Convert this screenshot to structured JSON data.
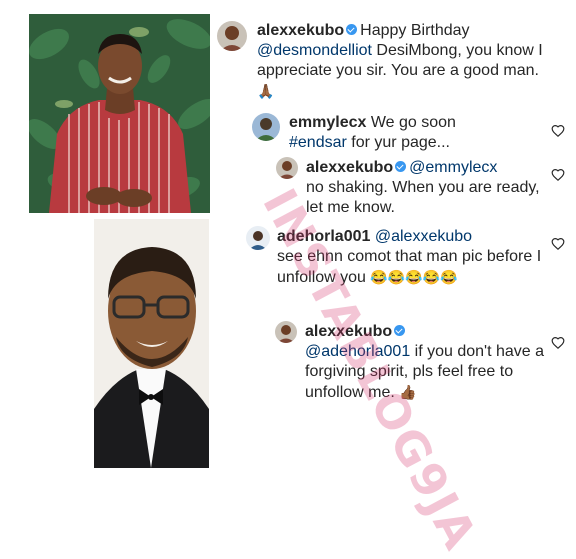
{
  "watermark": {
    "text": "INSTABLOG9JA"
  },
  "comments": [
    {
      "username": "alexxekubo",
      "verified": true,
      "text_before": "Happy Birthday",
      "mention": "@desmondelliot",
      "text_after": " DesiMbong, you know I appreciate you sir. You are a good man.",
      "emoji": "🙏🏾"
    },
    {
      "username": "emmylecx",
      "text_before": "We go soon",
      "hashtag": "#endsar",
      "text_after": " for yur page..."
    },
    {
      "username": "alexxekubo",
      "verified": true,
      "mention": "@emmylecx",
      "text_after": "no shaking. When you are ready, let me know."
    },
    {
      "username": "adehorla001",
      "mention": "@alexxekubo",
      "text_after": "see ehnn comot that man pic before I unfollow you",
      "emoji": "😂😂😂😂😂"
    },
    {
      "username": "alexxekubo",
      "verified": true,
      "mention": "@adehorla001",
      "text_after": " if you don't have a forgiving spirit, pls feel free to unfollow me.",
      "emoji": "👍🏾"
    }
  ],
  "icons": {
    "like": "heart-outline-icon",
    "verified": "verified-badge-icon"
  },
  "colors": {
    "mention": "#00376b",
    "verified": "#3897f0",
    "watermark": "#d6336c",
    "sweater": "#b83a3f",
    "foliage": "#2e5a3a"
  }
}
